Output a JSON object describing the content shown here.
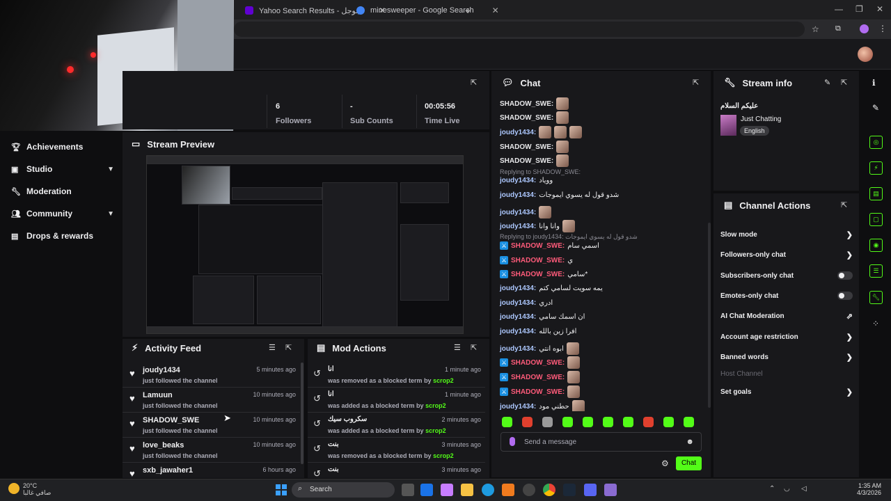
{
  "browser": {
    "tabs": [
      {
        "title": "Yahoo Search Results - جوجل",
        "favicon_color": "#6001d2"
      },
      {
        "title": "minesweeper - Google Search",
        "favicon_color": "#4285f4"
      }
    ],
    "new_tab": "+",
    "window_controls": [
      "—",
      "❐",
      "✕"
    ]
  },
  "stats": {
    "followers_value": "6",
    "followers_label": "Followers",
    "sub_value": "-",
    "sub_label": "Sub Counts",
    "time_value": "00:05:56",
    "time_label": "Time Live"
  },
  "sidebar": {
    "items": [
      {
        "label": "Achievements",
        "icon": "trophy-icon"
      },
      {
        "label": "Studio",
        "icon": "studio-icon"
      },
      {
        "label": "Moderation",
        "icon": "wrench-icon"
      },
      {
        "label": "Community",
        "icon": "users-icon"
      },
      {
        "label": "Drops & rewards",
        "icon": "gift-icon"
      }
    ]
  },
  "preview": {
    "title": "Stream Preview"
  },
  "activity": {
    "title": "Activity Feed",
    "items": [
      {
        "user": "joudy1434",
        "sub": "just followed the channel",
        "time": "5 minutes ago"
      },
      {
        "user": "Lamuun",
        "sub": "just followed the channel",
        "time": "10 minutes ago"
      },
      {
        "user": "SHADOW_SWE",
        "sub": "just followed the channel",
        "time": "10 minutes ago"
      },
      {
        "user": "love_beaks",
        "sub": "just followed the channel",
        "time": "10 minutes ago"
      },
      {
        "user": "sxb_jawaher1",
        "sub": "",
        "time": "6 hours ago"
      }
    ]
  },
  "mod_actions": {
    "title": "Mod Actions",
    "items": [
      {
        "term": "انا",
        "desc": "was removed as a blocked term by",
        "by": "scrop2",
        "time": "1 minute ago"
      },
      {
        "term": "انا",
        "desc": "was added as a blocked term by",
        "by": "scrop2",
        "time": "1 minute ago"
      },
      {
        "term": "سكروب سيك",
        "desc": "was added as a blocked term by",
        "by": "scrop2",
        "time": "2 minutes ago"
      },
      {
        "term": "بنت",
        "desc": "was removed as a blocked term by",
        "by": "scrop2",
        "time": "3 minutes ago"
      },
      {
        "term": "بنت",
        "desc": "",
        "by": "",
        "time": "3 minutes ago"
      }
    ]
  },
  "chat": {
    "title": "Chat",
    "lines": [
      {
        "name": "SHADOW_SWE:",
        "msg": "",
        "emotes": 1,
        "style": "w"
      },
      {
        "name": "SHADOW_SWE:",
        "msg": "",
        "emotes": 1,
        "style": "w"
      },
      {
        "name": "joudy1434:",
        "msg": "",
        "emotes": 3,
        "style": ""
      },
      {
        "name": "SHADOW_SWE:",
        "msg": "",
        "emotes": 1,
        "style": "w"
      },
      {
        "name": "SHADOW_SWE:",
        "msg": "",
        "emotes": 1,
        "style": "w"
      },
      {
        "reply": "Replying to SHADOW_SWE:"
      },
      {
        "name": "joudy1434:",
        "msg": "ووياد",
        "emotes": 0,
        "style": ""
      },
      {
        "name": "joudy1434:",
        "msg": "شدو قول له يسوي ايموجات",
        "emotes": 0,
        "style": ""
      },
      {
        "name": "joudy1434:",
        "msg": "",
        "emotes": 1,
        "style": ""
      },
      {
        "name": "joudy1434:",
        "msg": "وانا وانا",
        "emotes": 1,
        "style": ""
      },
      {
        "reply": "Replying to joudy1434: شدو قول له يسوي ايموجات"
      },
      {
        "name": "SHADOW_SWE:",
        "msg": "اسمي سام",
        "emotes": 0,
        "style": "mod"
      },
      {
        "name": "SHADOW_SWE:",
        "msg": "ي",
        "emotes": 0,
        "style": "mod"
      },
      {
        "name": "SHADOW_SWE:",
        "msg": "سامي*",
        "emotes": 0,
        "style": "mod"
      },
      {
        "name": "joudy1434:",
        "msg": "يمه سويت لسامي كتم",
        "emotes": 0,
        "style": ""
      },
      {
        "name": "joudy1434:",
        "msg": "ادري",
        "emotes": 0,
        "style": ""
      },
      {
        "name": "joudy1434:",
        "msg": "ان اسمك سامي",
        "emotes": 0,
        "style": ""
      },
      {
        "name": "joudy1434:",
        "msg": "افرا زين بالله",
        "emotes": 0,
        "style": ""
      },
      {
        "name": "joudy1434:",
        "msg": "ابوه انتي",
        "emotes": 1,
        "style": ""
      },
      {
        "name": "SHADOW_SWE:",
        "msg": "",
        "emotes": 1,
        "style": "mod"
      },
      {
        "name": "SHADOW_SWE:",
        "msg": "",
        "emotes": 1,
        "style": "mod"
      },
      {
        "name": "SHADOW_SWE:",
        "msg": "",
        "emotes": 1,
        "style": "mod"
      },
      {
        "name": "joudy1434:",
        "msg": "حطني مود",
        "emotes": 1,
        "style": ""
      }
    ],
    "placeholder": "Send a message",
    "send_label": "Chat"
  },
  "stream_info": {
    "title": "Stream info",
    "stream_title": "عليكم السلام",
    "category": "Just Chatting",
    "language": "English"
  },
  "channel_actions": {
    "title": "Channel Actions",
    "items": [
      {
        "label": "Slow mode",
        "kind": "chevron"
      },
      {
        "label": "Followers-only chat",
        "kind": "chevron"
      },
      {
        "label": "Subscribers-only chat",
        "kind": "toggle"
      },
      {
        "label": "Emotes-only chat",
        "kind": "toggle"
      },
      {
        "label": "AI Chat Moderation",
        "kind": "external"
      },
      {
        "label": "Account age restriction",
        "kind": "chevron"
      },
      {
        "label": "Banned words",
        "kind": "chevron"
      },
      {
        "label": "Host Channel",
        "kind": "dim"
      },
      {
        "label": "Set goals",
        "kind": "chevron"
      }
    ]
  },
  "taskbar": {
    "weather_temp": "20°C",
    "weather_desc": "صافي غالبا",
    "search_placeholder": "Search",
    "time": "1:35 AM",
    "date": "4/3/2026"
  }
}
